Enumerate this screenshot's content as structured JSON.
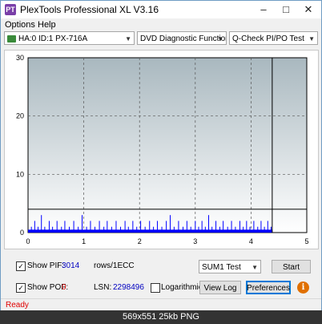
{
  "window": {
    "title": "PlexTools Professional XL V3.16",
    "icon_label": "PT"
  },
  "menu": {
    "options": "Options",
    "help": "Help"
  },
  "toolbar": {
    "drive": "HA:0 ID:1  PX-716A",
    "mode": "DVD Diagnostic Functions",
    "test": "Q-Check PI/PO Test"
  },
  "chart_data": {
    "type": "bar",
    "x_ticks": [
      "0",
      "1",
      "2",
      "3",
      "4",
      "5"
    ],
    "y_ticks": [
      "0",
      "10",
      "20",
      "30"
    ],
    "xlim": [
      0,
      5
    ],
    "ylim": [
      0,
      30
    ],
    "grid": true,
    "threshold_line": 4,
    "end_marker_x": 4.38,
    "colors": {
      "bars": "#0000ff",
      "background_top": "#a9b8bf",
      "background_bottom": "#ffffff"
    },
    "spikes": [
      [
        0.06,
        1
      ],
      [
        0.12,
        2
      ],
      [
        0.18,
        1
      ],
      [
        0.24,
        3
      ],
      [
        0.3,
        1
      ],
      [
        0.38,
        2
      ],
      [
        0.44,
        1
      ],
      [
        0.52,
        2
      ],
      [
        0.6,
        1
      ],
      [
        0.66,
        2
      ],
      [
        0.74,
        1
      ],
      [
        0.82,
        2
      ],
      [
        0.9,
        1
      ],
      [
        0.97,
        3
      ],
      [
        1.05,
        1
      ],
      [
        1.12,
        2
      ],
      [
        1.2,
        1
      ],
      [
        1.28,
        2
      ],
      [
        1.36,
        1
      ],
      [
        1.42,
        2
      ],
      [
        1.5,
        1
      ],
      [
        1.58,
        2
      ],
      [
        1.66,
        1
      ],
      [
        1.74,
        2
      ],
      [
        1.8,
        1
      ],
      [
        1.88,
        2
      ],
      [
        1.95,
        1
      ],
      [
        2.02,
        2
      ],
      [
        2.1,
        1
      ],
      [
        2.18,
        2
      ],
      [
        2.25,
        1
      ],
      [
        2.32,
        2
      ],
      [
        2.4,
        1
      ],
      [
        2.48,
        2
      ],
      [
        2.55,
        3
      ],
      [
        2.62,
        1
      ],
      [
        2.7,
        2
      ],
      [
        2.78,
        1
      ],
      [
        2.85,
        2
      ],
      [
        2.92,
        1
      ],
      [
        3.0,
        2
      ],
      [
        3.06,
        1
      ],
      [
        3.12,
        2
      ],
      [
        3.18,
        1
      ],
      [
        3.24,
        3
      ],
      [
        3.3,
        1
      ],
      [
        3.37,
        2
      ],
      [
        3.44,
        1
      ],
      [
        3.5,
        2
      ],
      [
        3.58,
        1
      ],
      [
        3.65,
        2
      ],
      [
        3.72,
        1
      ],
      [
        3.8,
        2
      ],
      [
        3.86,
        1
      ],
      [
        3.92,
        2
      ],
      [
        3.98,
        1
      ],
      [
        4.05,
        2
      ],
      [
        4.12,
        1
      ],
      [
        4.18,
        2
      ],
      [
        4.24,
        1
      ],
      [
        4.3,
        2
      ],
      [
        4.36,
        1
      ]
    ],
    "baseline_fill": 0.5
  },
  "controls": {
    "show_pif_label": "Show PIF:",
    "pif_value": "3014",
    "pif_units": "rows/1ECC",
    "show_pof_label": "Show POF:",
    "pof_value": "0",
    "lsn_label": "LSN:",
    "lsn_value": "2298496",
    "logarithmic_label": "Logarithmic",
    "sum_select": "SUM1 Test",
    "start": "Start",
    "view_log": "View Log",
    "preferences": "Preferences",
    "check_mark": "✓"
  },
  "status": "Ready",
  "caption": "569x551  25kb  PNG"
}
